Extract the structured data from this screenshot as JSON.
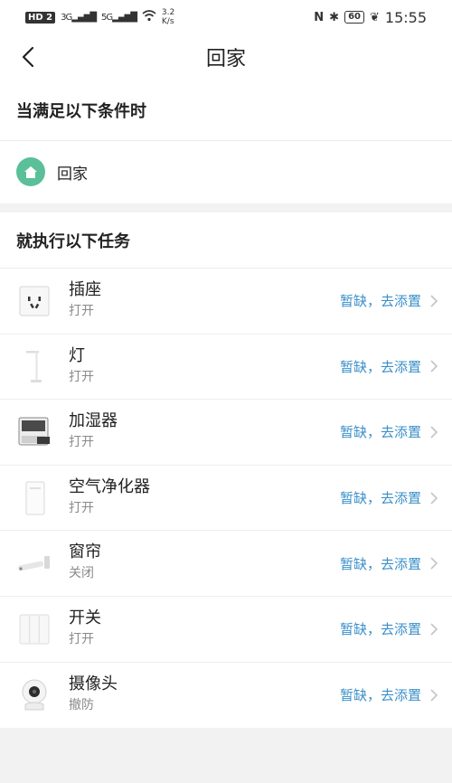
{
  "status_bar": {
    "hd_badge": "HD",
    "hd_sub": "2",
    "sig1": "3G",
    "sig2": "5G",
    "speed_value": "3.2",
    "speed_unit": "K/s",
    "nfc": "N",
    "bluetooth": "✱",
    "battery": "60",
    "leaf": "❦",
    "time": "15:55"
  },
  "nav": {
    "title": "回家"
  },
  "condition": {
    "title": "当满足以下条件时",
    "item_label": "回家"
  },
  "tasks": {
    "title": "就执行以下任务",
    "items": [
      {
        "name": "插座",
        "action": "打开",
        "link": "暂缺，去添置"
      },
      {
        "name": "灯",
        "action": "打开",
        "link": "暂缺，去添置"
      },
      {
        "name": "加湿器",
        "action": "打开",
        "link": "暂缺，去添置"
      },
      {
        "name": "空气净化器",
        "action": "打开",
        "link": "暂缺，去添置"
      },
      {
        "name": "窗帘",
        "action": "关闭",
        "link": "暂缺，去添置"
      },
      {
        "name": "开关",
        "action": "打开",
        "link": "暂缺，去添置"
      },
      {
        "name": "摄像头",
        "action": "撤防",
        "link": "暂缺，去添置"
      }
    ]
  },
  "colors": {
    "accent_link": "#3a8fc9",
    "home_icon_bg": "#5bbf9a",
    "page_bg": "#f2f2f2"
  }
}
